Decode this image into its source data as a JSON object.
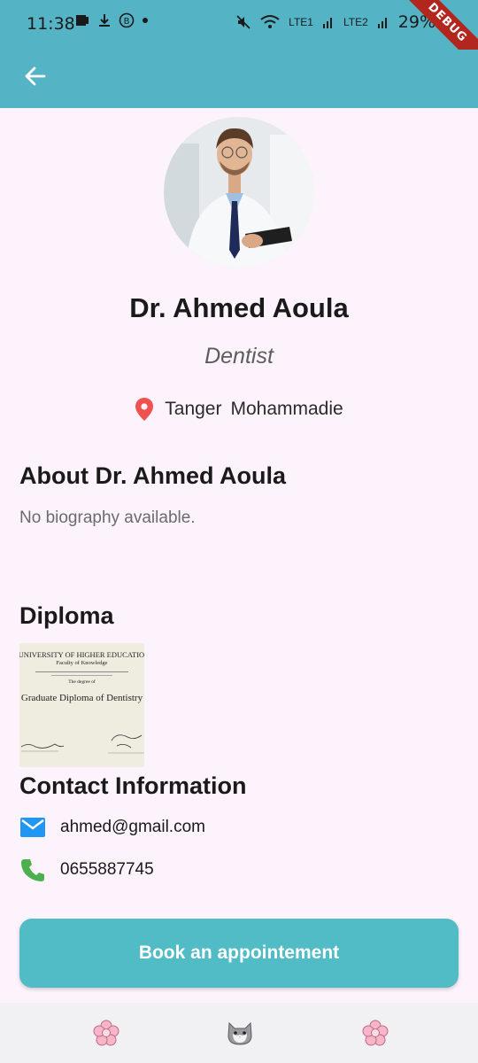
{
  "status_bar": {
    "time": "11:38",
    "battery": "29%",
    "sim1": "LTE1",
    "sim2": "LTE2",
    "debug_label": "DEBUG"
  },
  "doctor": {
    "name": "Dr. Ahmed Aoula",
    "specialty": "Dentist",
    "city": "Tanger",
    "district": "Mohammadie"
  },
  "about": {
    "title": "About Dr. Ahmed Aoula",
    "bio": "No biography available."
  },
  "diploma": {
    "title": "Diploma",
    "university": "UNIVERSITY OF HIGHER EDUCATION",
    "faculty": "Faculty of Knowledge",
    "degree_intro": "The degree of",
    "degree": "Graduate Diploma of Dentistry"
  },
  "contact": {
    "title": "Contact Information",
    "email": "ahmed@gmail.com",
    "phone": "0655887745"
  },
  "actions": {
    "book_label": "Book an appointement"
  },
  "colors": {
    "app_bar": "#55b3c6",
    "button": "#52bcc6",
    "background": "#fdf3fc",
    "location_pin": "#ef5350",
    "email_icon": "#2196f3",
    "phone_icon": "#4caf50"
  },
  "icons": {
    "back": "arrow-left-icon",
    "location": "location-pin-icon",
    "email": "mail-icon",
    "phone": "phone-icon",
    "nav_left": "flower-icon",
    "nav_center": "cat-icon",
    "nav_right": "flower-icon"
  }
}
